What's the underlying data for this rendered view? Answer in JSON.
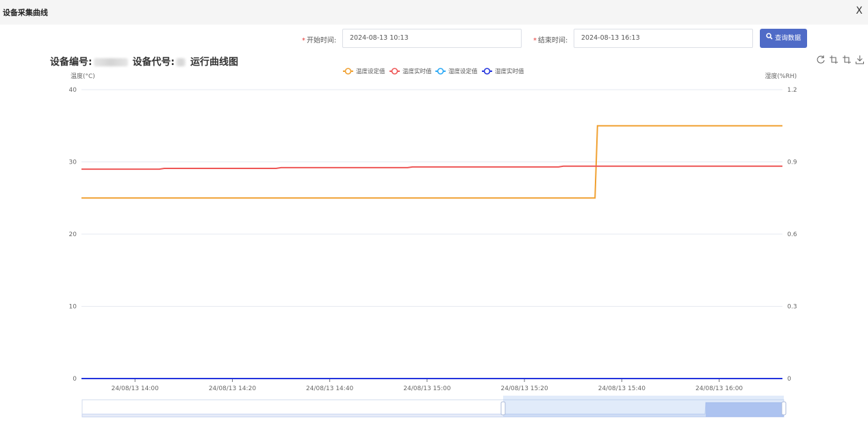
{
  "window": {
    "title": "设备采集曲线",
    "close_label": "X"
  },
  "form": {
    "start_label": "开始时间:",
    "start_value": "2024-08-13 10:13",
    "end_label": "结束时间:",
    "end_value": "2024-08-13 16:13",
    "required_mark": "*",
    "query_label": "查询数据"
  },
  "chart_title": {
    "device_no_label": "设备编号:",
    "device_code_label": "设备代号:",
    "suffix": "运行曲线图"
  },
  "toolbox": {
    "icons": [
      "refresh-icon",
      "restore-icon",
      "zoom-icon",
      "download-icon"
    ]
  },
  "colors": {
    "accent": "#4f6bc7",
    "temp_set": "#f0a030",
    "temp_real": "#ee5555",
    "hum_set": "#29a8f5",
    "hum_real": "#2233dd"
  },
  "chart_data": {
    "type": "line",
    "ylabel_left": "温度(°C)",
    "ylabel_right": "湿度(%RH)",
    "y_left_ticks": [
      "0",
      "10",
      "20",
      "30",
      "40"
    ],
    "y_right_ticks": [
      "0",
      "0.3",
      "0.6",
      "0.9",
      "1.2"
    ],
    "ylim_left": [
      0,
      40
    ],
    "ylim_right": [
      0,
      1.2
    ],
    "x_ticks": [
      "24/08/13 14:00",
      "24/08/13 14:20",
      "24/08/13 14:40",
      "24/08/13 15:00",
      "24/08/13 15:20",
      "24/08/13 15:40",
      "24/08/13 16:00"
    ],
    "x_tick_minutes": [
      840,
      860,
      880,
      900,
      920,
      940,
      960
    ],
    "xlim_minutes": [
      829,
      973
    ],
    "legend_position": "top-center",
    "grid": true,
    "series": [
      {
        "name": "温度设定值",
        "color": "#f0a030",
        "axis": "left",
        "points": [
          [
            829,
            25
          ],
          [
            934.5,
            25
          ],
          [
            935,
            35
          ],
          [
            973,
            35
          ]
        ]
      },
      {
        "name": "温度实时值",
        "color": "#ee5555",
        "axis": "left",
        "points": [
          [
            829,
            29
          ],
          [
            845,
            29
          ],
          [
            846,
            29.1
          ],
          [
            869,
            29.1
          ],
          [
            870,
            29.2
          ],
          [
            896,
            29.2
          ],
          [
            897,
            29.3
          ],
          [
            927,
            29.3
          ],
          [
            928,
            29.4
          ],
          [
            973,
            29.4
          ]
        ]
      },
      {
        "name": "湿度设定值",
        "color": "#29a8f5",
        "axis": "right",
        "points": [
          [
            829,
            0
          ],
          [
            973,
            0
          ]
        ]
      },
      {
        "name": "湿度实时值",
        "color": "#2233dd",
        "axis": "right",
        "points": [
          [
            829,
            0
          ],
          [
            973,
            0
          ]
        ]
      }
    ],
    "datazoom": {
      "start_percent": 60,
      "end_percent": 100
    }
  }
}
